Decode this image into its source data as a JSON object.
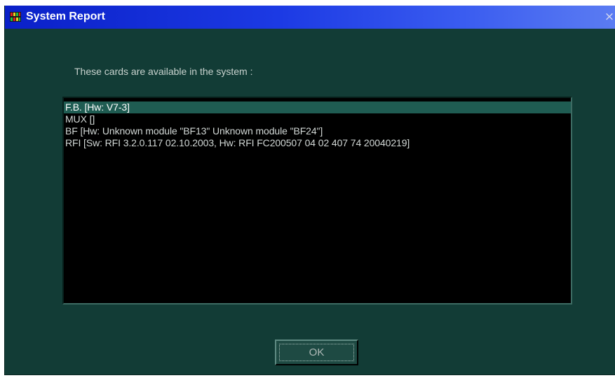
{
  "window": {
    "title": "System Report",
    "close_glyph": "×"
  },
  "dialog": {
    "prompt": "These cards are available in the system :",
    "cards": [
      "F.B. [Hw: V7-3]",
      "MUX []",
      "BF [Hw: Unknown module \"BF13\" Unknown module \"BF24\"]",
      "RFI [Sw: RFI 3.2.0.117 02.10.2003, Hw: RFI FC200507 04 02 407 74 20040219]"
    ],
    "selected_index": 0,
    "ok_label": "OK"
  },
  "icons": {
    "app": "app-icon",
    "close": "close-icon"
  },
  "colors": {
    "titlebar_start": "#0a20c8",
    "titlebar_end": "#5b7cf2",
    "dialog_background": "#123c36",
    "list_background": "#000000",
    "selection": "#1f5c52"
  }
}
